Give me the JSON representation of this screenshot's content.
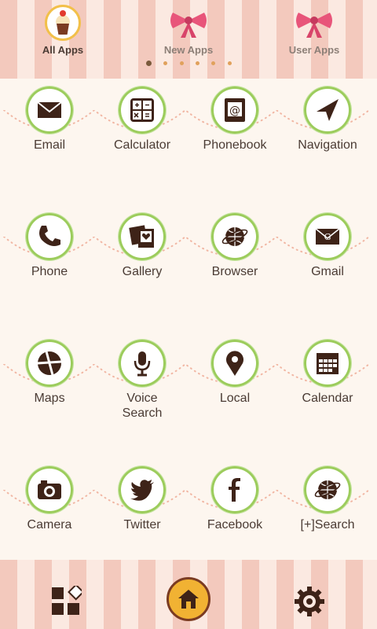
{
  "tabs": [
    {
      "label": "All Apps",
      "active": true
    },
    {
      "label": "New Apps",
      "active": false
    },
    {
      "label": "User Apps",
      "active": false
    }
  ],
  "page_indicator": {
    "count": 6,
    "current": 0
  },
  "apps": [
    {
      "label": "Email",
      "icon": "envelope-icon"
    },
    {
      "label": "Calculator",
      "icon": "calculator-icon"
    },
    {
      "label": "Phonebook",
      "icon": "address-book-icon"
    },
    {
      "label": "Navigation",
      "icon": "navigation-arrow-icon"
    },
    {
      "label": "Phone",
      "icon": "phone-handset-icon"
    },
    {
      "label": "Gallery",
      "icon": "photo-gallery-icon"
    },
    {
      "label": "Browser",
      "icon": "globe-icon"
    },
    {
      "label": "Gmail",
      "icon": "gmail-envelope-icon"
    },
    {
      "label": "Maps",
      "icon": "map-icon"
    },
    {
      "label": "Voice\nSearch",
      "icon": "microphone-icon"
    },
    {
      "label": "Local",
      "icon": "map-pin-icon"
    },
    {
      "label": "Calendar",
      "icon": "calendar-icon"
    },
    {
      "label": "Camera",
      "icon": "camera-icon"
    },
    {
      "label": "Twitter",
      "icon": "bird-icon"
    },
    {
      "label": "Facebook",
      "icon": "facebook-f-icon"
    },
    {
      "label": "[+]Search",
      "icon": "search-globe-icon"
    }
  ],
  "dock": {
    "left_icon": "app-grid-icon",
    "center_icon": "home-icon",
    "right_icon": "gear-icon"
  },
  "colors": {
    "stripe_pink": "#f3c9bd",
    "stripe_light": "#fbe9e1",
    "wreath_green": "#9ccc5c",
    "icon_brown": "#3e2318",
    "label_text": "#4a3b34",
    "accent_gold": "#f1b233"
  }
}
